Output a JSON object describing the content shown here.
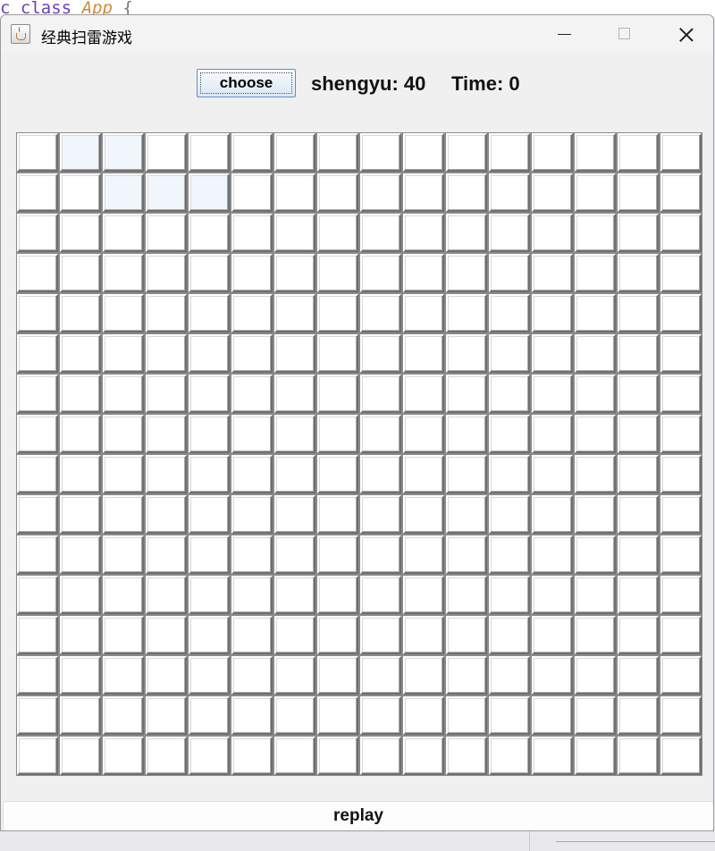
{
  "background_code": {
    "keyword1": "c",
    "keyword2": "class",
    "class_name": "App",
    "brace": "{"
  },
  "window": {
    "title": "经典扫雷游戏",
    "icon": "java-cup-icon"
  },
  "toolbar": {
    "choose_label": "choose",
    "remaining_text": "shengyu: 40",
    "time_text": "Time: 0"
  },
  "board": {
    "rows": 16,
    "cols": 16,
    "highlighted_cells": [
      [
        0,
        1
      ],
      [
        0,
        2
      ],
      [
        1,
        2
      ],
      [
        1,
        3
      ],
      [
        1,
        4
      ]
    ],
    "colors": {
      "cell_face": "#ffffff",
      "cell_hover": "#f0f6fc",
      "cell_shadow": "#6f6f6f"
    }
  },
  "footer": {
    "replay_label": "replay"
  },
  "colors": {
    "window_bg": "#f0f0f0",
    "button_border": "#5a8fd1"
  }
}
